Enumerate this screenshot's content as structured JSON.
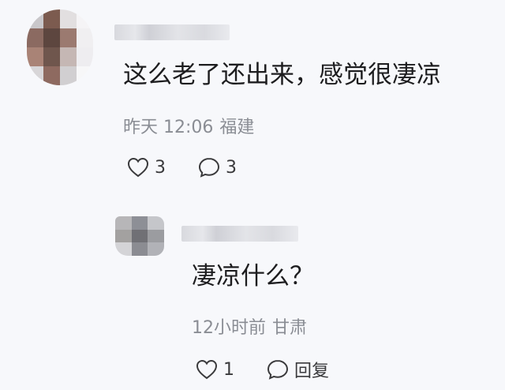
{
  "comment": {
    "text": "这么老了还出来，感觉很凄凉",
    "time": "昨天 12:06",
    "location": "福建",
    "like_count": "3",
    "reply_count": "3",
    "avatar_icon": "pixelated-avatar-icon",
    "username_state": "blurred"
  },
  "reply": {
    "text": "凄凉什么？",
    "time": "12小时前",
    "location": "甘肃",
    "like_count": "1",
    "reply_label": "回复",
    "avatar_icon": "pixelated-avatar-icon",
    "username_state": "blurred"
  },
  "colors": {
    "background": "#f7f8fb",
    "text": "#1d1d1f",
    "meta": "#8a8d94",
    "icon": "#3a3a3c"
  }
}
